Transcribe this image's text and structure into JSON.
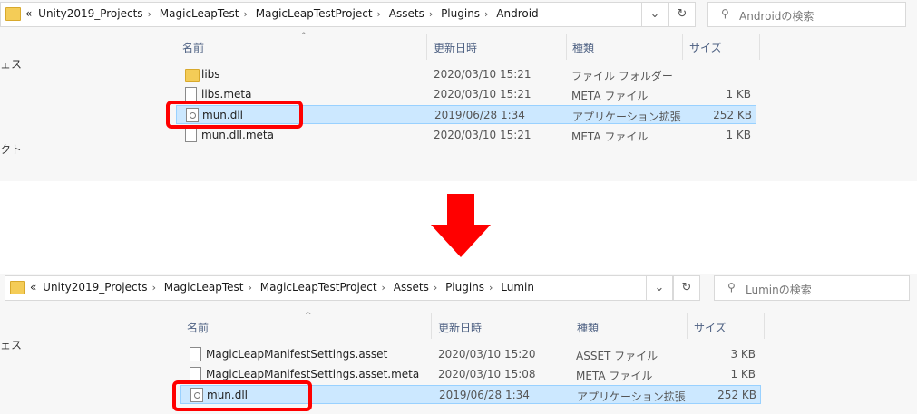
{
  "before": {
    "breadcrumb": [
      "«",
      "Unity2019_Projects",
      "MagicLeapTest",
      "MagicLeapTestProject",
      "Assets",
      "Plugins",
      "Android"
    ],
    "search_placeholder": "Androidの検索",
    "sidebar": [
      "ェス",
      "クト"
    ],
    "columns": {
      "name": "名前",
      "date": "更新日時",
      "type": "種類",
      "size": "サイズ"
    },
    "files": [
      {
        "name": "libs",
        "date": "2020/03/10 15:21",
        "type": "ファイル フォルダー",
        "size": "",
        "icon": "folder-icon"
      },
      {
        "name": "libs.meta",
        "date": "2020/03/10 15:21",
        "type": "META ファイル",
        "size": "1 KB",
        "icon": "file-icon"
      },
      {
        "name": "mun.dll",
        "date": "2019/06/28 1:34",
        "type": "アプリケーション拡張",
        "size": "252 KB",
        "icon": "dll-icon"
      },
      {
        "name": "mun.dll.meta",
        "date": "2020/03/10 15:21",
        "type": "META ファイル",
        "size": "1 KB",
        "icon": "file-icon"
      }
    ]
  },
  "after": {
    "breadcrumb": [
      "«",
      "Unity2019_Projects",
      "MagicLeapTest",
      "MagicLeapTestProject",
      "Assets",
      "Plugins",
      "Lumin"
    ],
    "search_placeholder": "Luminの検索",
    "sidebar": [
      "ェス"
    ],
    "columns": {
      "name": "名前",
      "date": "更新日時",
      "type": "種類",
      "size": "サイズ"
    },
    "files": [
      {
        "name": "MagicLeapManifestSettings.asset",
        "date": "2020/03/10 15:20",
        "type": "ASSET ファイル",
        "size": "3 KB",
        "icon": "file-icon"
      },
      {
        "name": "MagicLeapManifestSettings.asset.meta",
        "date": "2020/03/10 15:08",
        "type": "META ファイル",
        "size": "1 KB",
        "icon": "file-icon"
      },
      {
        "name": "mun.dll",
        "date": "2019/06/28 1:34",
        "type": "アプリケーション拡張",
        "size": "252 KB",
        "icon": "dll-icon"
      }
    ]
  },
  "colors": {
    "selection": "#cce8ff",
    "highlight": "#ff0000",
    "arrow": "#ff0000",
    "folder": "#f4cc57"
  }
}
